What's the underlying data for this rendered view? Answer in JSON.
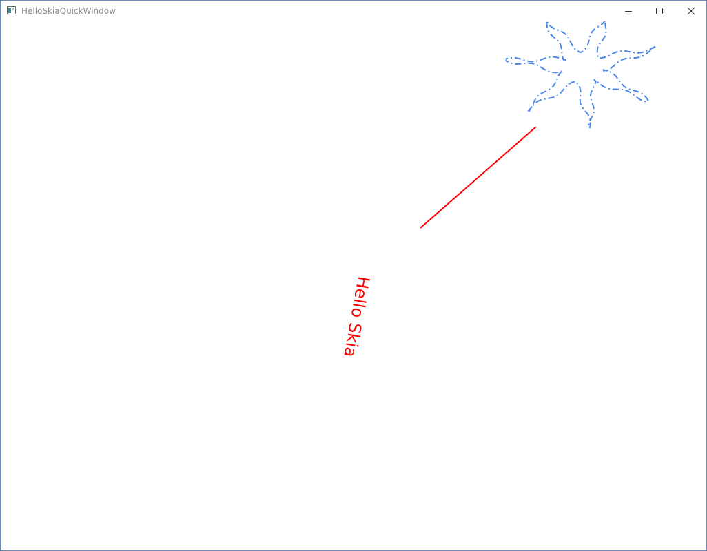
{
  "window": {
    "title": "HelloSkiaQuickWindow",
    "controls": {
      "minimize": "minimize-icon",
      "maximize": "maximize-icon",
      "close": "close-icon"
    }
  },
  "canvas": {
    "text": "Hello Skia",
    "colors": {
      "text": "#ff0000",
      "line": "#ff0000",
      "star": "#4a86e8",
      "frame": "#6d8bb8",
      "title": "#8a8a8a"
    }
  }
}
